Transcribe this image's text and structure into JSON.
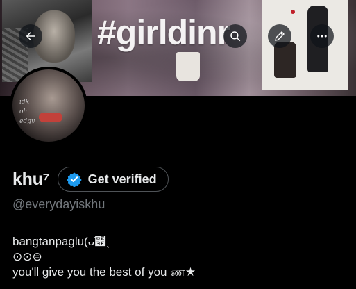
{
  "banner": {
    "text": "#girldinr"
  },
  "nav": {
    "back_icon": "arrow-left-icon",
    "search_icon": "search-icon",
    "edit_icon": "pencil-icon",
    "more_icon": "more-horizontal-icon"
  },
  "avatar": {
    "scribble": [
      "idk",
      "oh",
      "edgy"
    ]
  },
  "profile": {
    "display_name": "khu⁷",
    "verify_label": "Get verified",
    "handle": "@everydayiskhu",
    "bio_lines": [
      "bangtanpaglu(ᴗ͡฾ˎ",
      "⊙⊙⊜",
      "you'll give you the best of you ண★"
    ]
  },
  "colors": {
    "background": "#000000",
    "text_primary": "#e7e9ea",
    "text_secondary": "#71767b",
    "verify_blue": "#1d9bf0",
    "button_border": "#4f5357"
  }
}
